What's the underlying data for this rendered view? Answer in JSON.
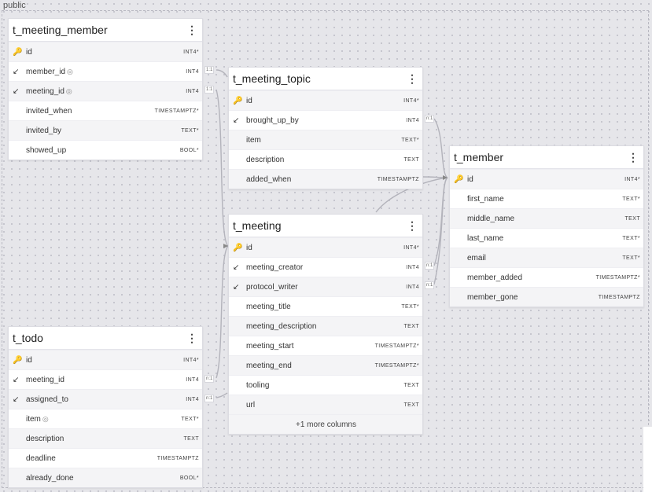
{
  "schema": {
    "name": "public"
  },
  "tables": {
    "t_meeting_member": {
      "name": "t_meeting_member",
      "menu": "⋮",
      "columns": [
        {
          "name": "id",
          "type": "INT4*",
          "icon": "key-icon"
        },
        {
          "name": "member_id",
          "type": "INT4",
          "icon": "foreign-key-icon",
          "fp": true
        },
        {
          "name": "meeting_id",
          "type": "INT4",
          "icon": "foreign-key-icon",
          "fp": true
        },
        {
          "name": "invited_when",
          "type": "TIMESTAMPTZ*"
        },
        {
          "name": "invited_by",
          "type": "TEXT*"
        },
        {
          "name": "showed_up",
          "type": "BOOL*"
        }
      ]
    },
    "t_meeting_topic": {
      "name": "t_meeting_topic",
      "menu": "⋮",
      "columns": [
        {
          "name": "id",
          "type": "INT4*",
          "icon": "key-icon"
        },
        {
          "name": "brought_up_by",
          "type": "INT4",
          "icon": "foreign-key-icon"
        },
        {
          "name": "item",
          "type": "TEXT*"
        },
        {
          "name": "description",
          "type": "TEXT"
        },
        {
          "name": "added_when",
          "type": "TIMESTAMPTZ"
        }
      ]
    },
    "t_member": {
      "name": "t_member",
      "menu": "⋮",
      "columns": [
        {
          "name": "id",
          "type": "INT4*",
          "icon": "key-icon"
        },
        {
          "name": "first_name",
          "type": "TEXT*"
        },
        {
          "name": "middle_name",
          "type": "TEXT"
        },
        {
          "name": "last_name",
          "type": "TEXT*"
        },
        {
          "name": "email",
          "type": "TEXT*"
        },
        {
          "name": "member_added",
          "type": "TIMESTAMPTZ*"
        },
        {
          "name": "member_gone",
          "type": "TIMESTAMPTZ"
        }
      ]
    },
    "t_meeting": {
      "name": "t_meeting",
      "menu": "⋮",
      "columns": [
        {
          "name": "id",
          "type": "INT4*",
          "icon": "key-icon"
        },
        {
          "name": "meeting_creator",
          "type": "INT4",
          "icon": "foreign-key-icon"
        },
        {
          "name": "protocol_writer",
          "type": "INT4",
          "icon": "foreign-key-icon"
        },
        {
          "name": "meeting_title",
          "type": "TEXT*"
        },
        {
          "name": "meeting_description",
          "type": "TEXT"
        },
        {
          "name": "meeting_start",
          "type": "TIMESTAMPTZ*"
        },
        {
          "name": "meeting_end",
          "type": "TIMESTAMPTZ*"
        },
        {
          "name": "tooling",
          "type": "TEXT"
        },
        {
          "name": "url",
          "type": "TEXT"
        }
      ],
      "more_columns": "+1 more columns"
    },
    "t_todo": {
      "name": "t_todo",
      "menu": "⋮",
      "columns": [
        {
          "name": "id",
          "type": "INT4*",
          "icon": "key-icon"
        },
        {
          "name": "meeting_id",
          "type": "INT4",
          "icon": "foreign-key-icon"
        },
        {
          "name": "assigned_to",
          "type": "INT4",
          "icon": "foreign-key-icon"
        },
        {
          "name": "item",
          "type": "TEXT*",
          "fp": true
        },
        {
          "name": "description",
          "type": "TEXT"
        },
        {
          "name": "deadline",
          "type": "TIMESTAMPTZ"
        },
        {
          "name": "already_done",
          "type": "BOOL*"
        }
      ]
    }
  },
  "cardinality": {
    "one_to_one": "1:1",
    "many_to_one": "n:1"
  },
  "icons": {
    "key-icon": "🔑",
    "foreign-key-icon": "↙",
    "fingerprint-icon": "◎"
  }
}
